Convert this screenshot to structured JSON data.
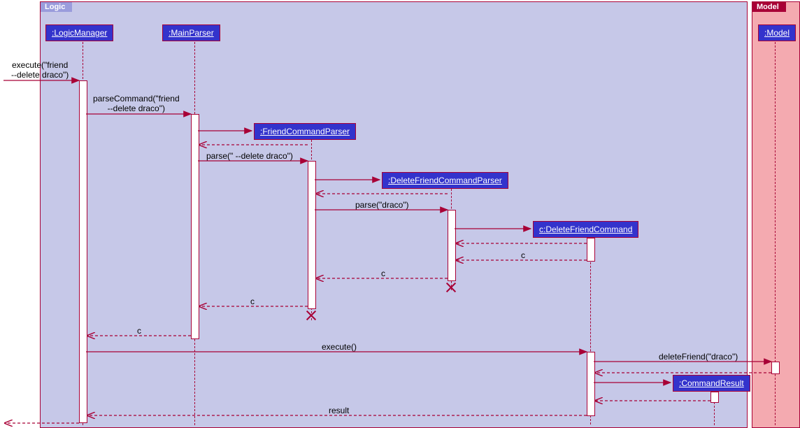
{
  "frames": {
    "logic": "Logic",
    "model": "Model"
  },
  "objects": {
    "logicManager": ":LogicManager",
    "mainParser": ":MainParser",
    "friendCmdParser": ":FriendCommandParser",
    "deleteFriendCmdParser": ":DeleteFriendCommandParser",
    "deleteFriendCmd": "c:DeleteFriendCommand",
    "model": ":Model",
    "commandResult": ":CommandResult"
  },
  "messages": {
    "m1": "execute(\"friend\n--delete draco\")",
    "m2": "parseCommand(\"friend\n--delete draco\")",
    "m3": "parse(\" --delete draco\")",
    "m4": "parse(\"draco\")",
    "m5": "c",
    "m6": "c",
    "m7": "c",
    "m8": "c",
    "m9": "execute()",
    "m10": "deleteFriend(\"draco\")",
    "m11": "result"
  }
}
